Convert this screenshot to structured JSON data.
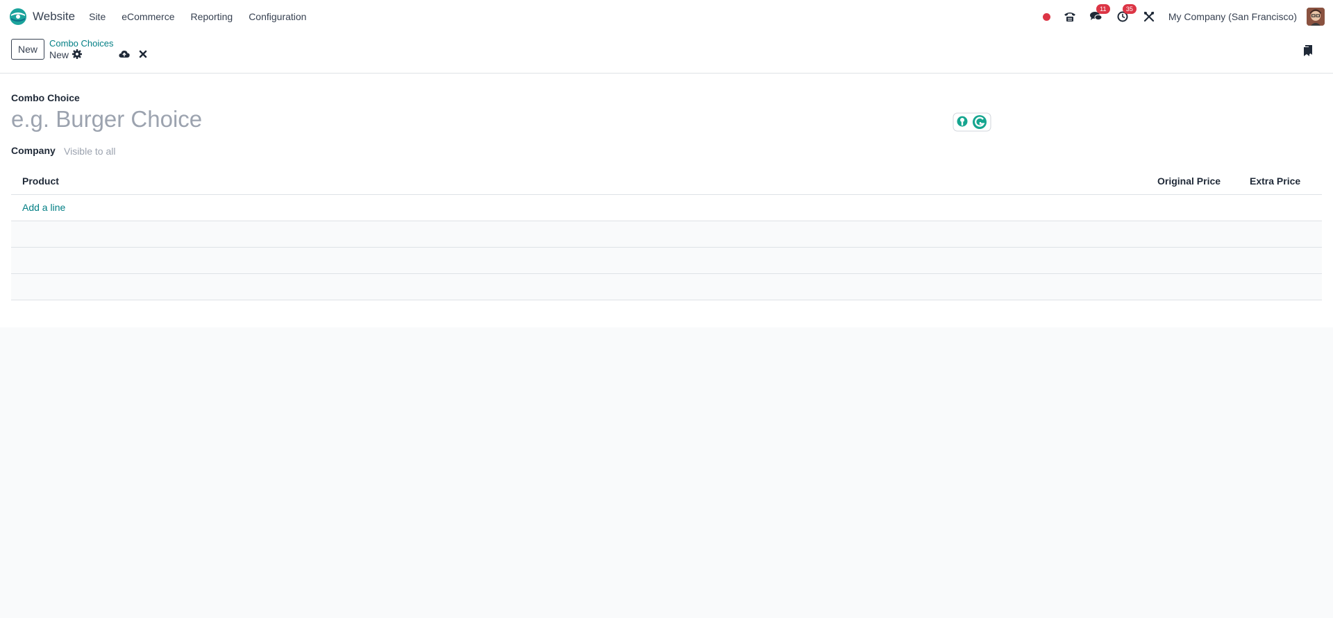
{
  "navbar": {
    "app_name": "Website",
    "menu": [
      "Site",
      "eCommerce",
      "Reporting",
      "Configuration"
    ],
    "messages_count": "11",
    "activities_count": "35",
    "company": "My Company (San Francisco)"
  },
  "control_panel": {
    "new_button": "New",
    "breadcrumb_parent": "Combo Choices",
    "breadcrumb_current": "New"
  },
  "form": {
    "name_label": "Combo Choice",
    "name_placeholder": "e.g. Burger Choice",
    "company_label": "Company",
    "company_value": "Visible to all"
  },
  "lines_table": {
    "columns": [
      "Product",
      "Original Price",
      "Extra Price"
    ],
    "add_line": "Add a line"
  },
  "colors": {
    "accent": "#017e84",
    "badge": "#dc3545",
    "background": "#f9fafb"
  }
}
